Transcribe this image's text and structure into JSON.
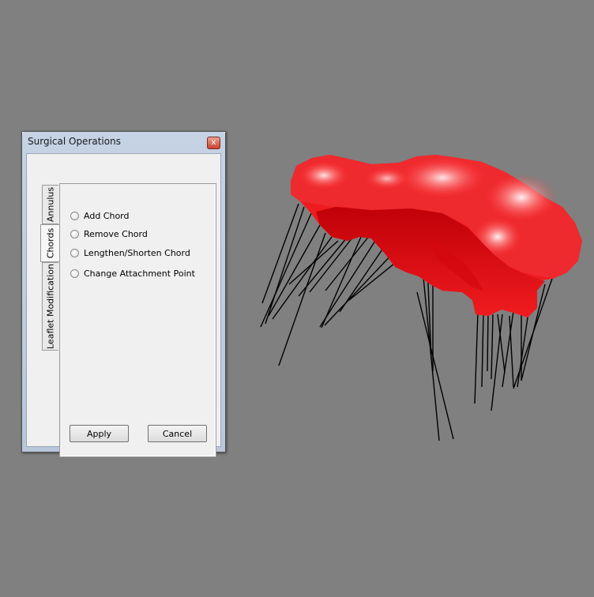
{
  "dialog": {
    "title": "Surgical Operations",
    "close_glyph": "x"
  },
  "tabs": [
    {
      "label": "Annulus",
      "selected": false
    },
    {
      "label": "Chords",
      "selected": true
    },
    {
      "label": "Leaflet Modification",
      "selected": false
    }
  ],
  "options": [
    {
      "label": "Add Chord",
      "checked": false
    },
    {
      "label": "Remove Chord",
      "checked": false
    },
    {
      "label": "Lengthen/Shorten Chord",
      "checked": false
    },
    {
      "label": "Change Attachment Point",
      "checked": false
    }
  ],
  "buttons": {
    "apply": "Apply",
    "cancel": "Cancel"
  },
  "colors": {
    "background": "#808080",
    "leaflet_base": "#e8141a",
    "leaflet_highlight": "#ffe0e0",
    "leaflet_shadow": "#b8000a",
    "chord": "#000000"
  },
  "icons": {
    "close": "close-icon"
  }
}
